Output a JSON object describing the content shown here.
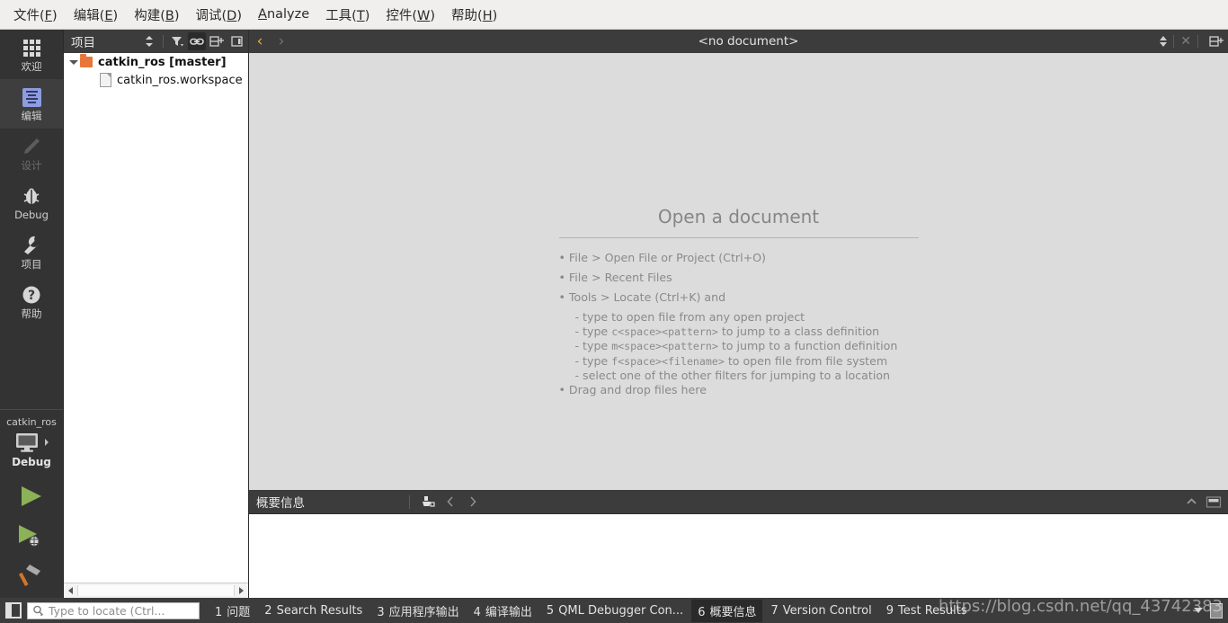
{
  "menubar": {
    "items": [
      {
        "label": "文件",
        "mnemonic": "F"
      },
      {
        "label": "编辑",
        "mnemonic": "E"
      },
      {
        "label": "构建",
        "mnemonic": "B"
      },
      {
        "label": "调试",
        "mnemonic": "D"
      },
      {
        "label": "Analyze",
        "mnemonic": "A",
        "inline_mnemonic": true
      },
      {
        "label": "工具",
        "mnemonic": "T"
      },
      {
        "label": "控件",
        "mnemonic": "W"
      },
      {
        "label": "帮助",
        "mnemonic": "H"
      }
    ]
  },
  "modebar": {
    "modes": [
      {
        "label": "欢迎",
        "icon": "grid-icon",
        "state": "normal"
      },
      {
        "label": "编辑",
        "icon": "edit-icon",
        "state": "selected"
      },
      {
        "label": "设计",
        "icon": "pencil-icon",
        "state": "disabled"
      },
      {
        "label": "Debug",
        "icon": "bug-icon",
        "state": "normal"
      },
      {
        "label": "项目",
        "icon": "wrench-icon",
        "state": "normal"
      },
      {
        "label": "帮助",
        "icon": "question-icon",
        "state": "normal"
      }
    ],
    "kit": {
      "project": "catkin_ros",
      "build_config": "Debug",
      "icon": "desktop-monitor-icon",
      "arrow": "chevron-right-icon"
    },
    "actions": [
      {
        "name": "run-button",
        "icon": "play-icon",
        "color": "#8cb258"
      },
      {
        "name": "debug-button",
        "icon": "play-bug-icon",
        "color": "#8cb258"
      },
      {
        "name": "build-button",
        "icon": "hammer-icon",
        "color": "#d2752a"
      }
    ]
  },
  "sidepanel": {
    "title": "项目",
    "tools": [
      {
        "name": "view-selector",
        "icon": "up-down-arrows-icon"
      },
      {
        "name": "filter-button",
        "icon": "filter-funnel-icon"
      },
      {
        "name": "sync-with-editor-button",
        "icon": "link-icon",
        "active": true
      },
      {
        "name": "split-button",
        "icon": "split-icon"
      },
      {
        "name": "close-sidebar-button",
        "icon": "close-panel-icon"
      }
    ],
    "tree": [
      {
        "label": "catkin_ros [master]",
        "icon": "folder-icon",
        "bold": true,
        "depth": 0,
        "expanded": true
      },
      {
        "label": "catkin_ros.workspace",
        "icon": "file-icon",
        "bold": false,
        "depth": 1
      }
    ]
  },
  "editor": {
    "toolbar": {
      "back": "‹",
      "forward": "›",
      "document": "<no document>",
      "close": "✕",
      "split_icon": "split-editor-icon"
    },
    "placeholder": {
      "title": "Open a document",
      "lines": [
        {
          "type": "bullet",
          "text": "• File > Open File or Project (Ctrl+O)"
        },
        {
          "type": "bullet",
          "text": "• File > Recent Files"
        },
        {
          "type": "bullet",
          "text": "• Tools > Locate (Ctrl+K) and"
        },
        {
          "type": "sub",
          "pre": "- type to open file from any open project"
        },
        {
          "type": "sub",
          "pre": "- type ",
          "mono": "c<space><pattern>",
          "post": " to jump to a class definition"
        },
        {
          "type": "sub",
          "pre": "- type ",
          "mono": "m<space><pattern>",
          "post": " to jump to a function definition"
        },
        {
          "type": "sub",
          "pre": "- type ",
          "mono": "f<space><filename>",
          "post": " to open file from file system"
        },
        {
          "type": "sub",
          "pre": "- select one of the other filters for jumping to a location"
        },
        {
          "type": "bullet",
          "text": "• Drag and drop files here"
        }
      ]
    }
  },
  "output_pane": {
    "title": "概要信息",
    "tools": [
      {
        "name": "clear-button",
        "icon": "broom-icon"
      },
      {
        "name": "prev-item-button",
        "icon": "chevron-left-icon"
      },
      {
        "name": "next-item-button",
        "icon": "chevron-right-icon"
      }
    ],
    "right_tools": [
      {
        "name": "collapse-button",
        "icon": "chevron-up-icon"
      },
      {
        "name": "maximize-button",
        "icon": "maximize-panel-icon"
      }
    ]
  },
  "statusbar": {
    "sidebar_toggle": {
      "name": "toggle-sidebar-button",
      "icon": "sidebar-icon"
    },
    "locator": {
      "placeholder": "Type to locate (Ctrl...",
      "icon": "search-icon"
    },
    "panes": [
      {
        "num": "1",
        "label": "问题",
        "selected": false
      },
      {
        "num": "2",
        "label": "Search Results",
        "selected": false
      },
      {
        "num": "3",
        "label": "应用程序输出",
        "selected": false
      },
      {
        "num": "4",
        "label": "编译输出",
        "selected": false
      },
      {
        "num": "5",
        "label": "QML Debugger Con...",
        "selected": false
      },
      {
        "num": "6",
        "label": "概要信息",
        "selected": true
      },
      {
        "num": "7",
        "label": "Version Control",
        "selected": false
      },
      {
        "num": "9",
        "label": "Test Results",
        "selected": false
      }
    ],
    "end_icons": [
      {
        "name": "pane-chevron-down-icon",
        "icon": "chevron-down-icon"
      },
      {
        "name": "progress-details-button",
        "icon": "panel-box-icon"
      }
    ]
  },
  "watermark": {
    "text": "https://blog.csdn.net/qq_43742383"
  }
}
